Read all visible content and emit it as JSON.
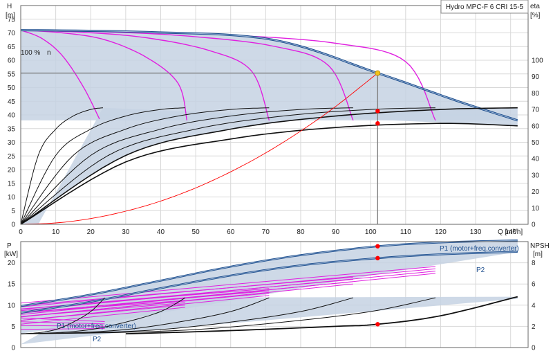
{
  "chart_data": [
    {
      "type": "line",
      "title": "Hydro MPC-F 6 CRI 15-5",
      "xlabel": "Q [m³/h]",
      "ylabel_left": "H",
      "ylabel_left_unit": "[m]",
      "ylabel_right": "eta",
      "ylabel_right_unit": "[%]",
      "xlim": [
        0,
        145
      ],
      "ylim_left": [
        0,
        80
      ],
      "ylim_right": [
        0,
        120
      ],
      "x_ticks": [
        "0",
        "10",
        "20",
        "30",
        "40",
        "50",
        "60",
        "70",
        "80",
        "90",
        "100",
        "110",
        "120",
        "130",
        "140"
      ],
      "y_left_ticks": [
        "0",
        "5",
        "10",
        "15",
        "20",
        "25",
        "30",
        "35",
        "40",
        "45",
        "50",
        "55",
        "60",
        "65",
        "70",
        "75"
      ],
      "y_right_ticks": [
        "0",
        "10",
        "20",
        "30",
        "40",
        "50",
        "60",
        "70",
        "80",
        "90",
        "100"
      ],
      "annotation_speed": "100 %",
      "annotation_speed_unit": "n",
      "duty_point": {
        "x": 102,
        "H": 55.3
      },
      "eta_markers": [
        {
          "x": 102,
          "eta": 69
        },
        {
          "x": 102,
          "eta": 61.5
        }
      ],
      "system_curve": {
        "x": [
          0,
          10,
          20,
          30,
          40,
          50,
          60,
          70,
          80,
          90,
          102
        ],
        "y": [
          0,
          0.5,
          2.1,
          4.8,
          8.5,
          13.3,
          19.2,
          26.1,
          34.1,
          43.1,
          55.3
        ]
      },
      "qh_full_speed": [
        {
          "pumps": 1,
          "x": [
            0,
            6,
            12,
            18,
            22.5
          ],
          "y": [
            71,
            68,
            61.5,
            50,
            38.5
          ]
        },
        {
          "pumps": 2,
          "x": [
            0,
            12,
            24,
            36,
            45,
            47.5
          ],
          "y": [
            71,
            70,
            67.5,
            61,
            51.5,
            38
          ]
        },
        {
          "pumps": 3,
          "x": [
            0,
            18,
            36,
            54,
            66,
            71
          ],
          "y": [
            71,
            70.2,
            68.2,
            63.5,
            56,
            38
          ]
        },
        {
          "pumps": 4,
          "x": [
            0,
            24,
            48,
            72,
            88,
            95
          ],
          "y": [
            71,
            70.4,
            68.8,
            65.2,
            58,
            38
          ]
        },
        {
          "pumps": 5,
          "x": [
            0,
            30,
            60,
            90,
            110,
            118.5
          ],
          "y": [
            71,
            70.5,
            69.2,
            66.2,
            59.5,
            38
          ]
        },
        {
          "pumps": 6,
          "x": [
            0,
            36,
            72,
            102,
            125,
            142
          ],
          "y": [
            71,
            70.3,
            67.5,
            55.3,
            45,
            38
          ]
        }
      ],
      "eta_curves": [
        {
          "pumps": 1,
          "x": [
            0,
            5,
            10,
            15,
            20,
            23.5
          ],
          "y": [
            0,
            42,
            58,
            66,
            70,
            71
          ]
        },
        {
          "pumps": 2,
          "x": [
            0,
            10,
            20,
            30,
            40,
            47
          ],
          "y": [
            0,
            42,
            58,
            66,
            70,
            71
          ]
        },
        {
          "pumps": 3,
          "x": [
            0,
            15,
            30,
            45,
            60,
            71
          ],
          "y": [
            0,
            42,
            58,
            66,
            70,
            71
          ]
        },
        {
          "pumps": 4,
          "x": [
            0,
            20,
            40,
            60,
            80,
            95
          ],
          "y": [
            0,
            42,
            58,
            66,
            70,
            71
          ]
        },
        {
          "pumps": 5,
          "x": [
            0,
            25,
            50,
            75,
            100,
            118.5
          ],
          "y": [
            0,
            42,
            58,
            66,
            70,
            71
          ]
        },
        {
          "pumps": 6,
          "x": [
            0,
            30,
            60,
            90,
            120,
            142
          ],
          "y": [
            0,
            42,
            58,
            66,
            70,
            71
          ]
        },
        {
          "pumps": 6,
          "x": [
            0,
            30,
            60,
            90,
            120,
            142
          ],
          "y": [
            0,
            38,
            52,
            59,
            61.5,
            60
          ]
        }
      ]
    },
    {
      "type": "line",
      "xlabel": "Q [m³/h]",
      "ylabel_left": "P",
      "ylabel_left_unit": "[kW]",
      "ylabel_right": "NPSH",
      "ylabel_right_unit": "[m]",
      "xlim": [
        0,
        145
      ],
      "ylim_left": [
        0,
        25
      ],
      "ylim_right": [
        0,
        10
      ],
      "y_left_ticks": [
        "0",
        "5",
        "10",
        "15",
        "20"
      ],
      "y_right_ticks": [
        "0",
        "2",
        "4",
        "6",
        "8"
      ],
      "series": [
        {
          "name": "P1 (motor+freq.converter)",
          "x": [
            0,
            20,
            40,
            60,
            80,
            102,
            120,
            142
          ],
          "y": [
            9.8,
            12.5,
            15.8,
            19.1,
            21.8,
            23.9,
            24.8,
            25.3
          ]
        },
        {
          "name": "P2",
          "x": [
            0,
            20,
            40,
            60,
            80,
            102,
            120,
            142
          ],
          "y": [
            8.2,
            10.8,
            14,
            17,
            19.4,
            21.1,
            22,
            22.6
          ]
        }
      ],
      "power_fan_curves": [
        {
          "pumps": 1,
          "x": [
            0,
            24
          ],
          "y": [
            4.3,
            4.5
          ]
        },
        {
          "pumps": 2,
          "x": [
            0,
            47
          ],
          "y": [
            5.5,
            9.5
          ]
        },
        {
          "pumps": 3,
          "x": [
            0,
            71
          ],
          "y": [
            6.4,
            12.3
          ]
        },
        {
          "pumps": 4,
          "x": [
            0,
            95
          ],
          "y": [
            7.2,
            15
          ]
        },
        {
          "pumps": 5,
          "x": [
            0,
            118.5
          ],
          "y": [
            7.8,
            17.5
          ]
        }
      ],
      "npsh_curves": [
        {
          "x": [
            0,
            5,
            10,
            15,
            20,
            24
          ],
          "y": [
            1.3,
            1.4,
            1.7,
            2.4,
            3.4,
            4.7
          ]
        },
        {
          "x": [
            0,
            10,
            20,
            30,
            40,
            47
          ],
          "y": [
            1.3,
            1.4,
            1.7,
            2.4,
            3.4,
            4.7
          ]
        },
        {
          "x": [
            0,
            15,
            30,
            45,
            60,
            71
          ],
          "y": [
            1.3,
            1.4,
            1.7,
            2.4,
            3.4,
            4.7
          ]
        },
        {
          "x": [
            0,
            20,
            40,
            60,
            80,
            95
          ],
          "y": [
            1.3,
            1.4,
            1.7,
            2.4,
            3.4,
            4.7
          ]
        },
        {
          "x": [
            0,
            25,
            50,
            75,
            100,
            118.5
          ],
          "y": [
            1.3,
            1.4,
            1.7,
            2.4,
            3.4,
            4.7
          ]
        },
        {
          "x": [
            30,
            60,
            90,
            102,
            120,
            142
          ],
          "y": [
            1.3,
            1.6,
            2,
            2.2,
            3,
            4.8
          ]
        }
      ],
      "markers": [
        {
          "x": 102,
          "P": 23.9
        },
        {
          "x": 102,
          "P": 21.1
        },
        {
          "x": 102,
          "NPSH": 2.2
        }
      ],
      "legend_labels": {
        "p1": "P1 (motor+freq.converter)",
        "p2": "P2"
      },
      "colors": {
        "envelope": "#c5d2e3",
        "curve_blue": "#1e4f8f",
        "pink": "#e020e0",
        "black": "#111111",
        "red": "#ff0000",
        "duty": "#f2c21b"
      }
    }
  ]
}
